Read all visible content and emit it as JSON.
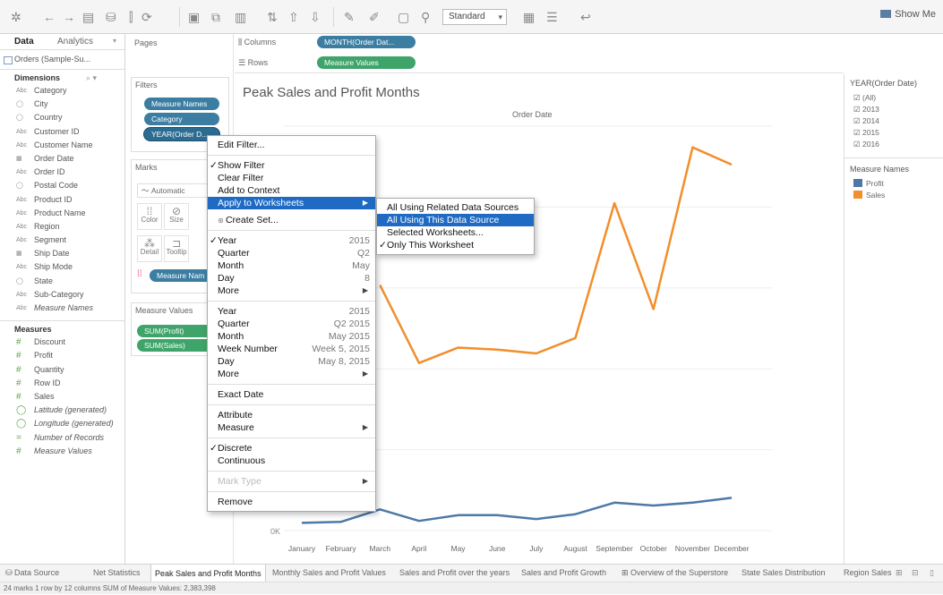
{
  "toolbar": {
    "fit_value": "Standard",
    "show_me_label": "Show Me"
  },
  "data_pane": {
    "tab_data": "Data",
    "tab_analytics": "Analytics",
    "data_source": "Orders (Sample-Su...",
    "dimensions_header": "Dimensions",
    "dimensions": [
      {
        "icon": "Abc",
        "label": "Category"
      },
      {
        "icon": "◯",
        "label": "City"
      },
      {
        "icon": "◯",
        "label": "Country"
      },
      {
        "icon": "Abc",
        "label": "Customer ID"
      },
      {
        "icon": "Abc",
        "label": "Customer Name"
      },
      {
        "icon": "▦",
        "label": "Order Date"
      },
      {
        "icon": "Abc",
        "label": "Order ID"
      },
      {
        "icon": "◯",
        "label": "Postal Code"
      },
      {
        "icon": "Abc",
        "label": "Product ID"
      },
      {
        "icon": "Abc",
        "label": "Product Name"
      },
      {
        "icon": "Abc",
        "label": "Region"
      },
      {
        "icon": "Abc",
        "label": "Segment"
      },
      {
        "icon": "▦",
        "label": "Ship Date"
      },
      {
        "icon": "Abc",
        "label": "Ship Mode"
      },
      {
        "icon": "◯",
        "label": "State"
      },
      {
        "icon": "Abc",
        "label": "Sub-Category"
      },
      {
        "icon": "Abc",
        "label": "Measure Names"
      }
    ],
    "measures_header": "Measures",
    "measures": [
      {
        "icon": "#",
        "label": "Discount"
      },
      {
        "icon": "#",
        "label": "Profit"
      },
      {
        "icon": "#",
        "label": "Quantity"
      },
      {
        "icon": "#",
        "label": "Row ID"
      },
      {
        "icon": "#",
        "label": "Sales"
      },
      {
        "icon": "◯",
        "label": "Latitude (generated)"
      },
      {
        "icon": "◯",
        "label": "Longitude (generated)"
      },
      {
        "icon": "=",
        "label": "Number of Records"
      },
      {
        "icon": "#",
        "label": "Measure Values"
      }
    ]
  },
  "shelves": {
    "pages_label": "Pages",
    "filters_label": "Filters",
    "filter_pills": [
      "Measure Names",
      "Category",
      "YEAR(Order D..."
    ],
    "marks_label": "Marks",
    "mark_type": "Automatic",
    "mark_buttons": [
      "Color",
      "Size",
      "Detail",
      "Tooltip"
    ],
    "marks_pill": "Measure Nam",
    "measure_values_label": "Measure Values",
    "measure_value_pills": [
      "SUM(Profit)",
      "SUM(Sales)"
    ],
    "columns_label": "Columns",
    "columns_pill": "MONTH(Order Dat...",
    "rows_label": "Rows",
    "rows_pill": "Measure Values"
  },
  "view": {
    "title": "Peak Sales and Profit Months",
    "header": "Order Date",
    "axis_zero": "0K"
  },
  "chart_data": {
    "type": "line",
    "title": "Peak Sales and Profit Months",
    "xlabel": "Order Date",
    "categories": [
      "January",
      "February",
      "March",
      "April",
      "May",
      "June",
      "July",
      "August",
      "September",
      "October",
      "November",
      "December"
    ],
    "series": [
      {
        "name": "Sales",
        "color": "#f28e2b",
        "values": [
          null,
          null,
          255,
          174,
          190,
          188,
          184,
          200,
          340,
          230,
          398,
          380
        ]
      },
      {
        "name": "Profit",
        "color": "#4e79a7",
        "values": [
          8,
          9,
          22,
          10,
          16,
          16,
          12,
          17,
          29,
          26,
          29,
          34
        ]
      }
    ],
    "ylim": [
      0,
      420
    ],
    "legend": "right"
  },
  "legend": {
    "year_header": "YEAR(Order Date)",
    "year_options": [
      "(All)",
      "2013",
      "2014",
      "2015",
      "2016"
    ],
    "measure_header": "Measure Names",
    "measures": [
      {
        "label": "Profit",
        "color": "#4e79a7"
      },
      {
        "label": "Sales",
        "color": "#f28e2b"
      }
    ]
  },
  "context_menu": {
    "items": [
      {
        "type": "item",
        "label": "Edit Filter..."
      },
      {
        "type": "sep"
      },
      {
        "type": "item",
        "label": "Show Filter",
        "check": "✓"
      },
      {
        "type": "item",
        "label": "Clear Filter"
      },
      {
        "type": "item",
        "label": "Add to Context"
      },
      {
        "type": "item",
        "label": "Apply to Worksheets",
        "submenu": true,
        "highlight": true
      },
      {
        "type": "gap"
      },
      {
        "type": "item",
        "label": "Create Set..."
      },
      {
        "type": "sep"
      },
      {
        "type": "item",
        "label": "Year",
        "check": "✓",
        "value": "2015"
      },
      {
        "type": "item",
        "label": "Quarter",
        "value": "Q2"
      },
      {
        "type": "item",
        "label": "Month",
        "value": "May"
      },
      {
        "type": "item",
        "label": "Day",
        "value": "8"
      },
      {
        "type": "item",
        "label": "More",
        "submenu": true
      },
      {
        "type": "sep"
      },
      {
        "type": "item",
        "label": "Year",
        "value": "2015"
      },
      {
        "type": "item",
        "label": "Quarter",
        "value": "Q2 2015"
      },
      {
        "type": "item",
        "label": "Month",
        "value": "May 2015"
      },
      {
        "type": "item",
        "label": "Week Number",
        "value": "Week 5, 2015"
      },
      {
        "type": "item",
        "label": "Day",
        "value": "May 8, 2015"
      },
      {
        "type": "item",
        "label": "More",
        "submenu": true
      },
      {
        "type": "sep"
      },
      {
        "type": "item",
        "label": "Exact Date"
      },
      {
        "type": "sep"
      },
      {
        "type": "item",
        "label": "Attribute"
      },
      {
        "type": "item",
        "label": "Measure",
        "submenu": true
      },
      {
        "type": "sep"
      },
      {
        "type": "item",
        "label": "Discrete",
        "check": "✓"
      },
      {
        "type": "item",
        "label": "Continuous"
      },
      {
        "type": "sep"
      },
      {
        "type": "item",
        "label": "Mark Type",
        "submenu": true,
        "disabled": true
      },
      {
        "type": "sep"
      },
      {
        "type": "item",
        "label": "Remove"
      }
    ]
  },
  "submenu": {
    "items": [
      {
        "label": "All Using Related Data Sources"
      },
      {
        "label": "All Using This Data Source",
        "highlight": true
      },
      {
        "label": "Selected Worksheets..."
      },
      {
        "label": "Only This Worksheet",
        "check": "✓"
      }
    ]
  },
  "sheet_tabs": {
    "data_source_tab": "Data Source",
    "tabs": [
      "Net Statistics",
      "Peak Sales and Profit Months",
      "Monthly Sales and Profit Values",
      "Sales and Profit over the years",
      "Sales and Profit Growth",
      "Overview of the Superstore",
      "State Sales Distribution",
      "Region Sales"
    ],
    "active_index": 1
  },
  "status": {
    "text": "24 marks   1 row by 12 columns   SUM of Measure Values: 2,383,398"
  }
}
